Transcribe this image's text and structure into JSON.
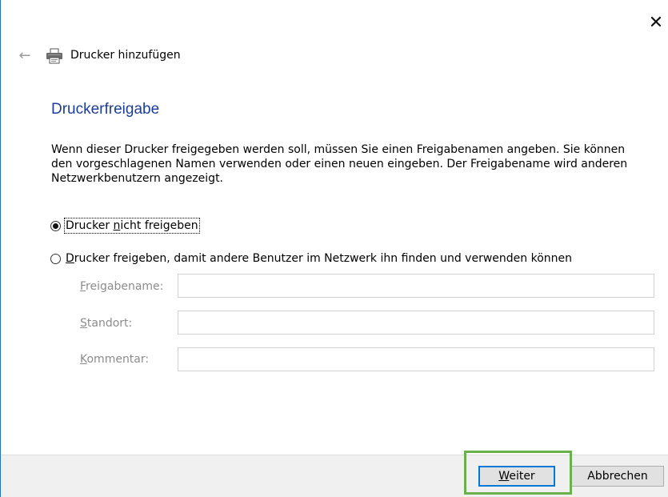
{
  "window": {
    "close_glyph": "✕",
    "back_glyph": "←",
    "title": "Drucker hinzufügen"
  },
  "page": {
    "heading": "Druckerfreigabe",
    "description": "Wenn dieser Drucker freigegeben werden soll, müssen Sie einen Freigabenamen angeben. Sie können den vorgeschlagenen Namen verwenden oder einen neuen eingeben. Der Freigabename wird anderen Netzwerkbenutzern angezeigt."
  },
  "options": {
    "no_share": {
      "label_pre": "Drucker ",
      "label_accel": "n",
      "label_post": "icht freigeben",
      "selected": true
    },
    "share": {
      "label_accel": "D",
      "label_post": "rucker freigeben, damit andere Benutzer im Netzwerk ihn finden und verwenden können",
      "selected": false
    }
  },
  "fields": {
    "share_name": {
      "accel": "F",
      "rest": "reigabename:",
      "value": ""
    },
    "location": {
      "accel": "S",
      "rest": "tandort:",
      "value": ""
    },
    "comment": {
      "accel": "K",
      "rest": "ommentar:",
      "value": ""
    }
  },
  "buttons": {
    "next": {
      "accel": "W",
      "rest": "eiter"
    },
    "cancel": "Abbrechen"
  },
  "colors": {
    "heading": "#1b3e9a",
    "highlight": "#6ab04c",
    "focus_border": "#0078d7"
  }
}
